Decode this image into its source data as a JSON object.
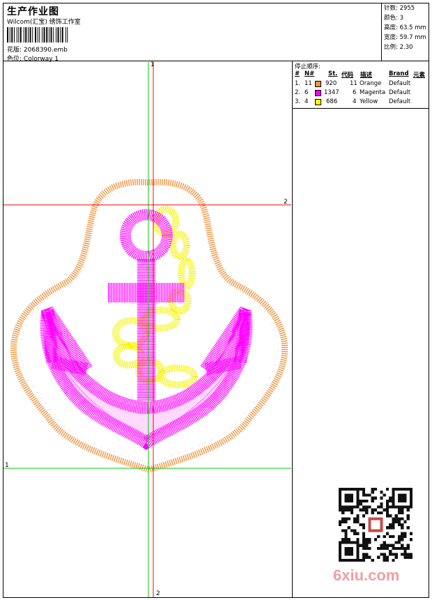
{
  "header": {
    "title": "生产作业图",
    "subtitle": "Wilcom(汇宝) 绣饰工作室",
    "pattern_label": "花版:",
    "pattern_file": "2068390.emb",
    "colorway_label": "色位:",
    "colorway_value": "Colorway 1"
  },
  "stats": [
    {
      "label": "针数:",
      "value": "2955"
    },
    {
      "label": "颜色:",
      "value": "3"
    },
    {
      "label": "高度:",
      "value": "63.5 mm"
    },
    {
      "label": "宽度:",
      "value": "59.7 mm"
    },
    {
      "label": "比例:",
      "value": "2.30"
    }
  ],
  "stop_sequence": {
    "title": "停止顺序:",
    "columns": [
      "#",
      "N#",
      "St.",
      "代码",
      "描述",
      "Brand",
      "元素"
    ],
    "rows": [
      {
        "idx": "1.",
        "n": "11",
        "color": "#ef9340",
        "st": "920",
        "code": "11",
        "desc": "Orange",
        "brand": "Default"
      },
      {
        "idx": "2.",
        "n": "6",
        "color": "#ff00ff",
        "st": "1347",
        "code": "6",
        "desc": "Magenta",
        "brand": "Default"
      },
      {
        "idx": "3.",
        "n": "4",
        "color": "#ffff00",
        "st": "686",
        "code": "4",
        "desc": "Yellow",
        "brand": "Default"
      }
    ]
  },
  "axes": {
    "v_green_top": "1",
    "h_red_right": "2",
    "h_green_left": "1",
    "v_red_bottom": "2"
  },
  "colors": {
    "orange": "#ef9340",
    "magenta": "#ff00ff",
    "yellow": "#f4f400",
    "guide_red": "#ff0000",
    "guide_green": "#00cc00"
  },
  "watermark": "6xiu.com"
}
